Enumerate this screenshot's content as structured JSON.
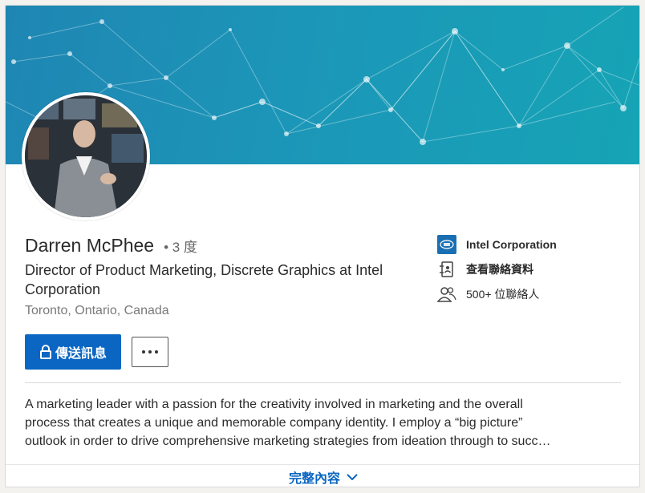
{
  "profile": {
    "name": "Darren McPhee",
    "degree": "• 3 度",
    "headline": "Director of Product Marketing, Discrete Graphics at Intel Corporation",
    "location": "Toronto, Ontario, Canada"
  },
  "actions": {
    "message_label": "傳送訊息",
    "more_label": "···"
  },
  "sidebar": {
    "company": "Intel Corporation",
    "contact_info": "查看聯絡資料",
    "connections": "500+ 位聯絡人"
  },
  "summary": {
    "line1": "A marketing leader with a passion for the creativity involved in marketing and the overall",
    "line2": "process that creates a unique and memorable company identity. I employ a “big picture”",
    "line3": "outlook in order to drive comprehensive marketing strategies from ideation through to succ…"
  },
  "footer": {
    "show_more": "完整內容"
  },
  "icons": {
    "logo": "intel-logo-icon",
    "contact": "address-book-icon",
    "connections": "people-icon",
    "lock": "lock-icon",
    "chevron": "chevron-down-icon"
  },
  "colors": {
    "primary": "#0a66c2",
    "banner": "#1c96b8"
  }
}
